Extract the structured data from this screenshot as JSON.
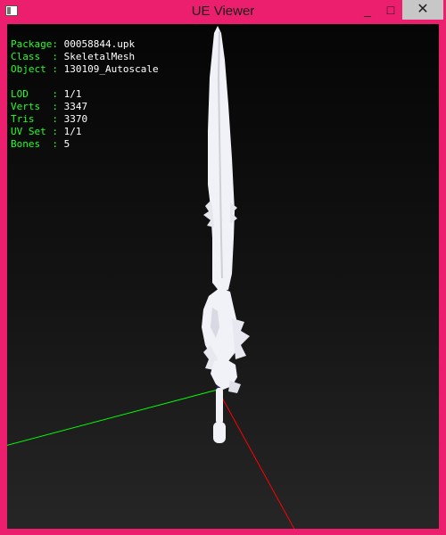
{
  "window": {
    "title": "UE Viewer",
    "controls": {
      "minimize": "_",
      "maximize": "□",
      "close": "✕"
    }
  },
  "info": {
    "package_label": "Package: ",
    "package_value": "00058844.upk",
    "class_label": "Class  : ",
    "class_value": "SkeletalMesh",
    "object_label": "Object : ",
    "object_value": "130109_Autoscale",
    "lod_label": "LOD    : ",
    "lod_value": "1/1",
    "verts_label": "Verts  : ",
    "verts_value": "3347",
    "tris_label": "Tris   : ",
    "tris_value": "3370",
    "uvset_label": "UV Set : ",
    "uvset_value": "1/1",
    "bones_label": "Bones  : ",
    "bones_value": "5"
  },
  "colors": {
    "frame": "#ec1e6e",
    "info_label": "#22ff22",
    "info_value": "#ffffff",
    "axis_x": "#ff0000",
    "axis_y": "#00ff00",
    "mesh": "#f2f2f8"
  },
  "icons": {
    "app": "app-window-icon"
  }
}
